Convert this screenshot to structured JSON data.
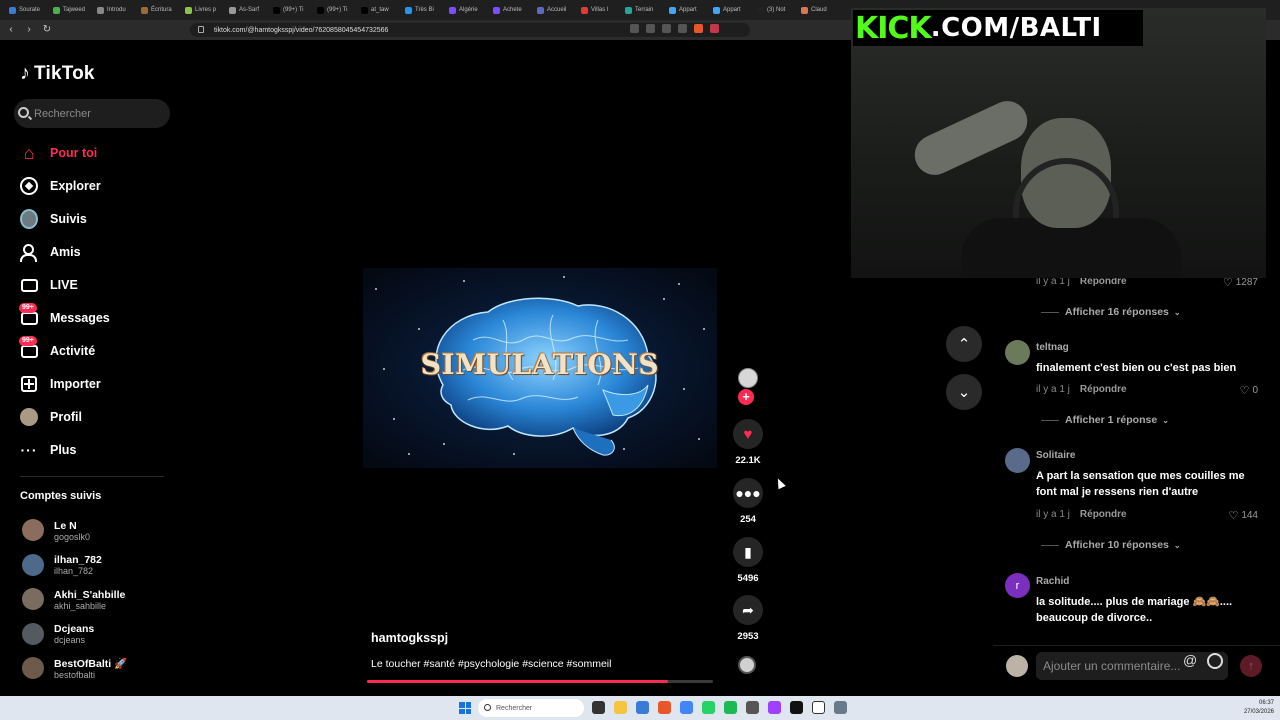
{
  "browser": {
    "tabs": [
      {
        "label": "Sourate",
        "color": "#3a7bd5"
      },
      {
        "label": "Tajweed",
        "color": "#4caf50"
      },
      {
        "label": "Introdu",
        "color": "#888888"
      },
      {
        "label": "Écritura",
        "color": "#9c6b3c"
      },
      {
        "label": "Livres p",
        "color": "#8bc34a"
      },
      {
        "label": "As-Sarf",
        "color": "#999999"
      },
      {
        "label": "(99+) Ti",
        "color": "#000000"
      },
      {
        "label": "(99+) Ti",
        "color": "#000000"
      },
      {
        "label": "at_taw",
        "color": "#000000"
      },
      {
        "label": "Très Bi",
        "color": "#2196f3"
      },
      {
        "label": "Algérie",
        "color": "#7c4dff"
      },
      {
        "label": "Achete",
        "color": "#7c4dff"
      },
      {
        "label": "Accueil",
        "color": "#5c6bc0"
      },
      {
        "label": "Villas I",
        "color": "#e53935"
      },
      {
        "label": "Terrain",
        "color": "#26a69a"
      },
      {
        "label": "Appart",
        "color": "#42a5f5"
      },
      {
        "label": "Appart",
        "color": "#42a5f5"
      },
      {
        "label": "(3) Not",
        "color": "#222222"
      },
      {
        "label": "Claud",
        "color": "#d97757"
      }
    ],
    "url": "tiktok.com/@hamtogksspj/video/7620858045454732566"
  },
  "sidebar": {
    "logo_text": "TikTok",
    "search_placeholder": "Rechercher",
    "nav": [
      {
        "label": "Pour toi",
        "icon": "home-icon",
        "active": true
      },
      {
        "label": "Explorer",
        "icon": "compass-icon"
      },
      {
        "label": "Suivis",
        "icon": "following-avatar-icon"
      },
      {
        "label": "Amis",
        "icon": "friends-icon"
      },
      {
        "label": "LIVE",
        "icon": "live-icon"
      },
      {
        "label": "Messages",
        "icon": "messages-icon",
        "badge": "99+"
      },
      {
        "label": "Activité",
        "icon": "activity-icon",
        "badge": "99+"
      },
      {
        "label": "Importer",
        "icon": "upload-icon"
      },
      {
        "label": "Profil",
        "icon": "profile-avatar-icon"
      },
      {
        "label": "Plus",
        "icon": "more-dots-icon"
      }
    ],
    "followed_title": "Comptes suivis",
    "followed": [
      {
        "name": "Le N",
        "username": "gogoslk0",
        "color": "#8a6d5c"
      },
      {
        "name": "ilhan_782",
        "username": "ilhan_782",
        "color": "#4d6a8a"
      },
      {
        "name": "Akhi_S'ahbille",
        "username": "akhi_sahbille",
        "color": "#7a6d60"
      },
      {
        "name": "Dcjeans",
        "username": "dcjeans",
        "color": "#555a60"
      },
      {
        "name": "BestOfBalti 🚀",
        "username": "bestofbalti",
        "color": "#6e5a4a"
      }
    ]
  },
  "video": {
    "title_text": "SIMULATIONS",
    "author": "hamtogksspj",
    "caption": "Le toucher #santé #psychologie #science #sommeil",
    "progress": 0.87
  },
  "actions": {
    "likes": "22.1K",
    "comments": "254",
    "saves": "5496",
    "shares": "2953"
  },
  "stream_overlay": {
    "brand_green": "KICK",
    "brand_white": ".COM/BALTI"
  },
  "comments": [
    {
      "meta": "il y a 1 j",
      "reply": "Répondre",
      "likes": "1287"
    },
    {
      "more": "Afficher 16 réponses"
    },
    {
      "author": "teltnag",
      "text": "finalement c'est bien ou c'est pas bien",
      "meta": "il y a 1 j",
      "reply": "Répondre",
      "likes": "0",
      "more": "Afficher 1 réponse",
      "color": "#6a7a5a"
    },
    {
      "author": "Solitaire",
      "text": "A part la sensation que mes couilles me font mal je ressens rien d'autre",
      "meta": "il y a 1 j",
      "reply": "Répondre",
      "likes": "144",
      "more": "Afficher 10 réponses",
      "color": "#5a6a8a"
    },
    {
      "author": "Rachid",
      "text": "la solitude.... plus de mariage 🙈🙈.... beaucoup de divorce..",
      "avatar_letter": "r",
      "color": "#7b2fbf"
    }
  ],
  "comment_input": {
    "placeholder": "Ajouter un commentaire..."
  },
  "taskbar": {
    "search": "Rechercher",
    "time": "06:37",
    "date": "27/03/2026"
  }
}
